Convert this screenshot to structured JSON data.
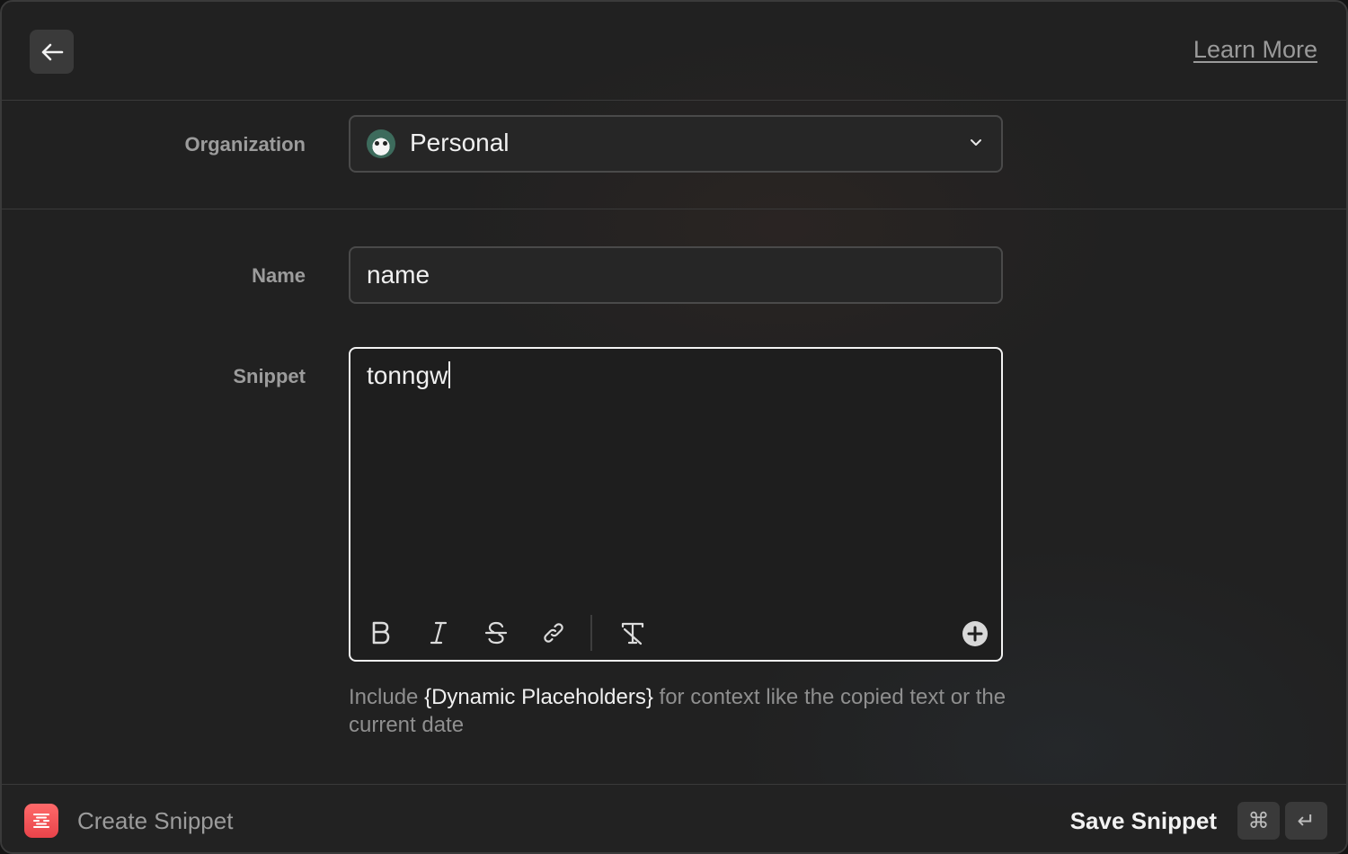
{
  "header": {
    "back_icon": "arrow-left-icon",
    "learn_more": "Learn More"
  },
  "form": {
    "organization": {
      "label": "Organization",
      "value": "Personal",
      "avatar_icon": "panda-avatar-icon",
      "dropdown_icon": "chevron-down-icon"
    },
    "name": {
      "label": "Name",
      "value": "name"
    },
    "snippet": {
      "label": "Snippet",
      "value": "tonngw",
      "toolbar": [
        "bold-icon",
        "italic-icon",
        "strikethrough-icon",
        "link-icon",
        "clear-format-icon"
      ],
      "add_icon": "plus-circle-icon"
    },
    "hint": {
      "before": "Include ",
      "highlight": "{Dynamic Placeholders}",
      "after": " for context like the copied text or the current date"
    }
  },
  "footer": {
    "app_icon": "snippet-app-icon",
    "title": "Create Snippet",
    "action": "Save Snippet",
    "shortcut": [
      "⌘",
      "↵"
    ]
  },
  "colors": {
    "background": "#212121",
    "border": "#3a3a3a",
    "accent_app": "#e8444a",
    "text_primary": "#f0f0f0",
    "text_secondary": "#9c9c9c"
  }
}
